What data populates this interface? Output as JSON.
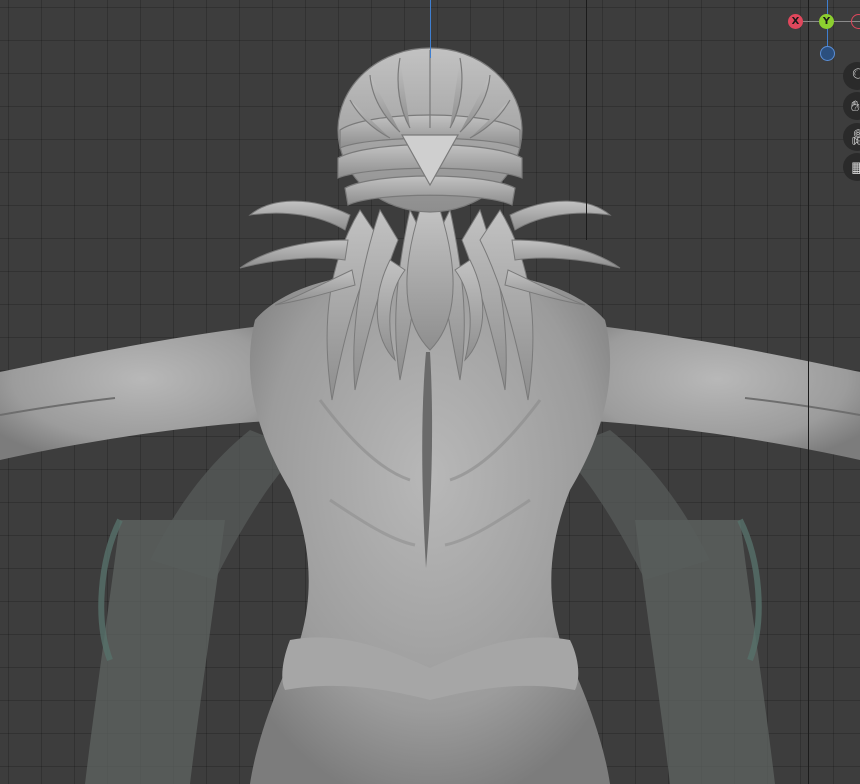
{
  "viewport": {
    "background": "#3d3d3d",
    "gizmo": {
      "x_label": "X",
      "y_label": "Y",
      "x_color": "#e0475c",
      "y_color": "#8ccf2f",
      "z_color": "#3f7fd0"
    },
    "navigation_icons": [
      "zoom-icon",
      "hand-pan-icon",
      "camera-icon",
      "grid-icon"
    ]
  }
}
